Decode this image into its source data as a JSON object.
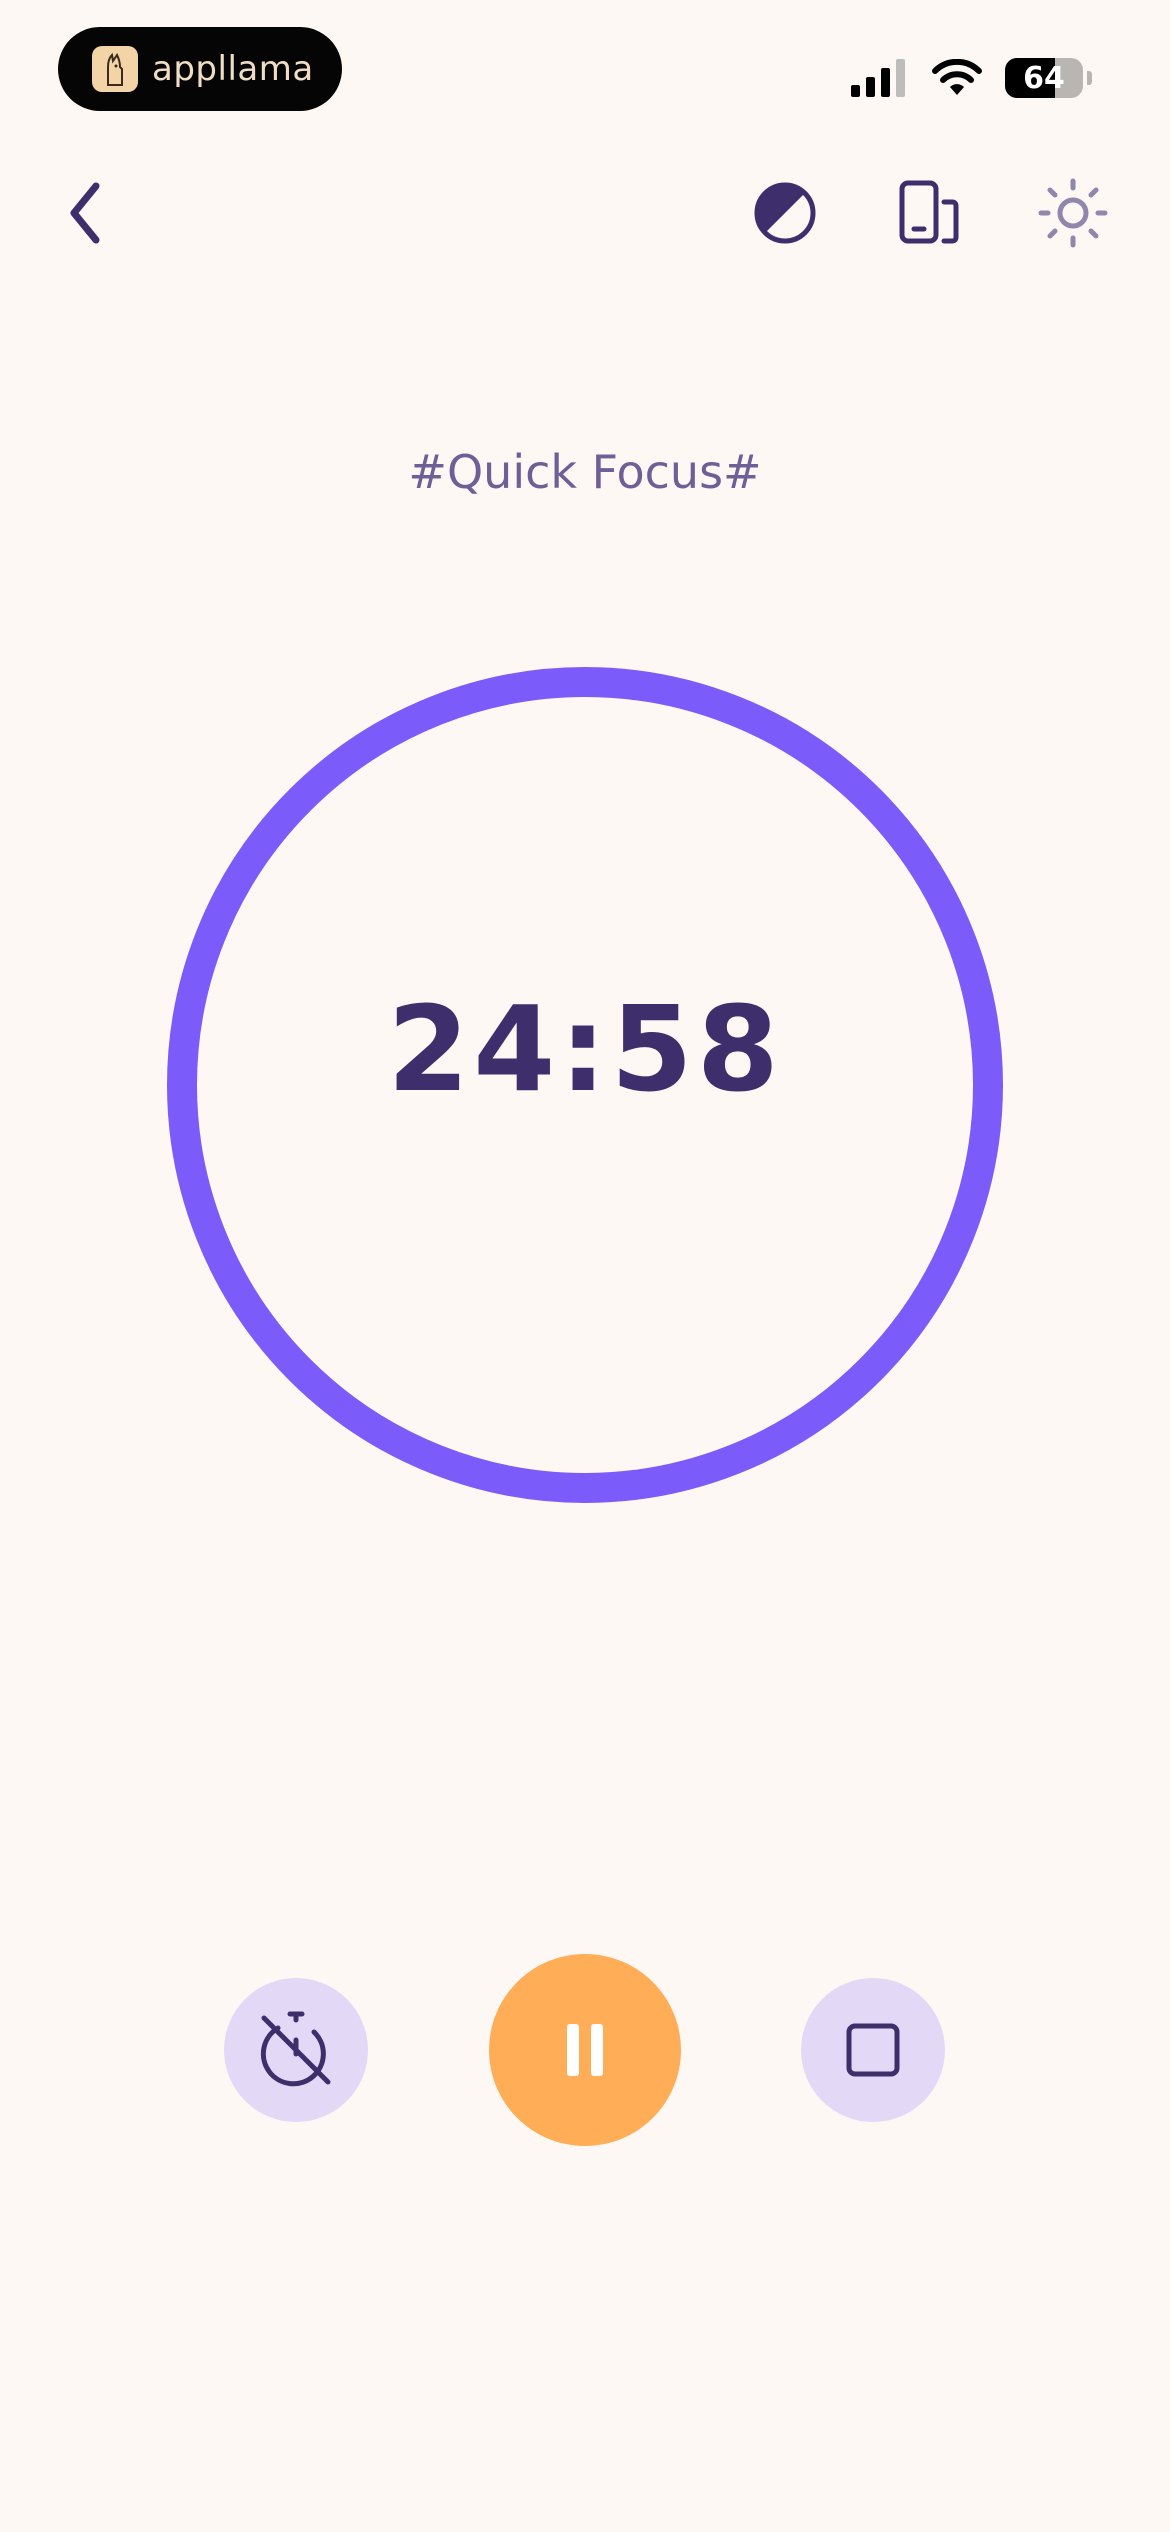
{
  "status_bar": {
    "app_name": "appllama",
    "battery_percent": "64",
    "battery_level": 0.64
  },
  "colors": {
    "background": "#FDF8F4",
    "accent": "#7B5CFA",
    "primary_text": "#3E2E6C",
    "pause_button": "#FFAD57",
    "secondary_button": "#E4D8F7"
  },
  "header": {
    "back_icon": "chevron-left-icon",
    "theme_icon": "contrast-icon",
    "device_icon": "devices-icon",
    "brightness_icon": "sun-icon"
  },
  "session": {
    "label": "#Quick Focus#"
  },
  "timer": {
    "time": "24:58"
  },
  "controls": {
    "left_icon": "timer-off-icon",
    "center_icon": "pause-icon",
    "right_icon": "stop-icon"
  }
}
